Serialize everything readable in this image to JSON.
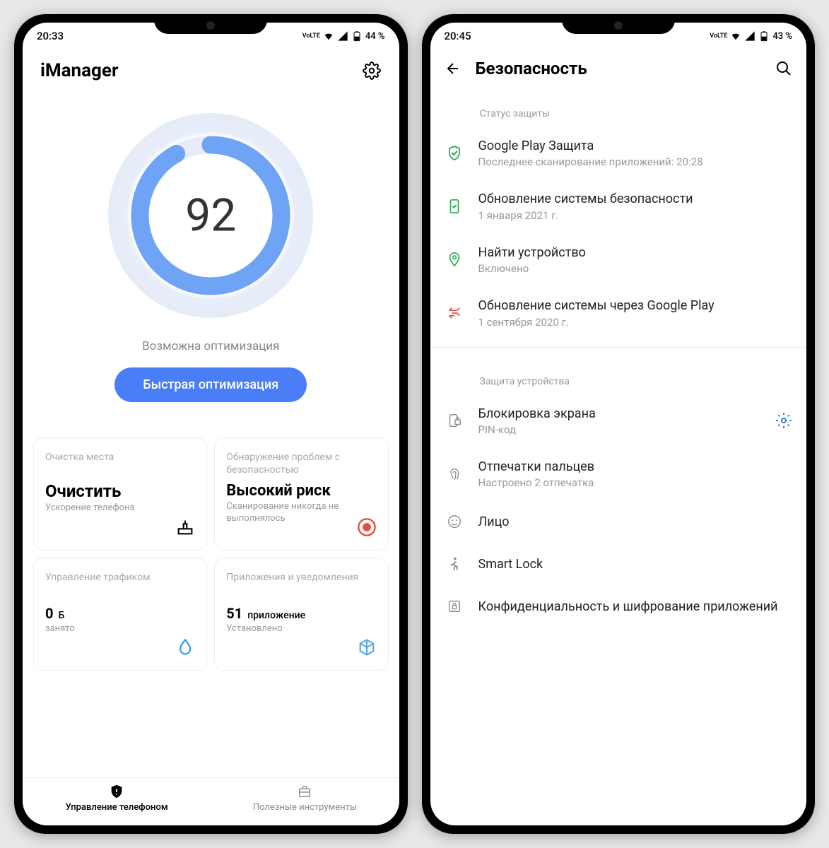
{
  "phone1": {
    "status": {
      "time": "20:33",
      "battery": "44 %",
      "lte": "VoLTE"
    },
    "app_title": "iManager",
    "score": "92",
    "score_percent": 92,
    "hint": "Возможна оптимизация",
    "optimize_btn": "Быстрая оптимизация",
    "cards": {
      "clean": {
        "label": "Очистка места",
        "title": "Очистить",
        "sub": "Ускорение телефона"
      },
      "security": {
        "label": "Обнаружение проблем с безопасностью",
        "title": "Высокий риск",
        "sub": "Сканирование никогда не выполнялось"
      },
      "traffic": {
        "label": "Управление трафиком",
        "value": "0",
        "unit": "Б",
        "sub": "занято"
      },
      "apps": {
        "label": "Приложения и уведомления",
        "value": "51",
        "unit": "приложение",
        "sub": "Установлено"
      }
    },
    "nav": {
      "tab1": "Управление телефоном",
      "tab2": "Полезные инструменты"
    }
  },
  "phone2": {
    "status": {
      "time": "20:45",
      "battery": "43 %",
      "lte": "VoLTE"
    },
    "page_title": "Безопасность",
    "section1": "Статус защиты",
    "section2": "Защита устройства",
    "items": {
      "play_protect": {
        "title": "Google Play Защита",
        "sub": "Последнее сканирование приложений: 20:28"
      },
      "sec_update": {
        "title": "Обновление системы безопасности",
        "sub": "1 января 2021 г."
      },
      "find_device": {
        "title": "Найти устройство",
        "sub": "Включено"
      },
      "play_update": {
        "title": "Обновление системы через Google Play",
        "sub": "1 сентября 2020 г."
      },
      "lock": {
        "title": "Блокировка экрана",
        "sub": "PIN-код"
      },
      "fingerprint": {
        "title": "Отпечатки пальцев",
        "sub": "Настроено 2 отпечатка"
      },
      "face": {
        "title": "Лицо"
      },
      "smartlock": {
        "title": "Smart Lock"
      },
      "encryption": {
        "title": "Конфиденциальность и шифрование приложений"
      }
    }
  }
}
